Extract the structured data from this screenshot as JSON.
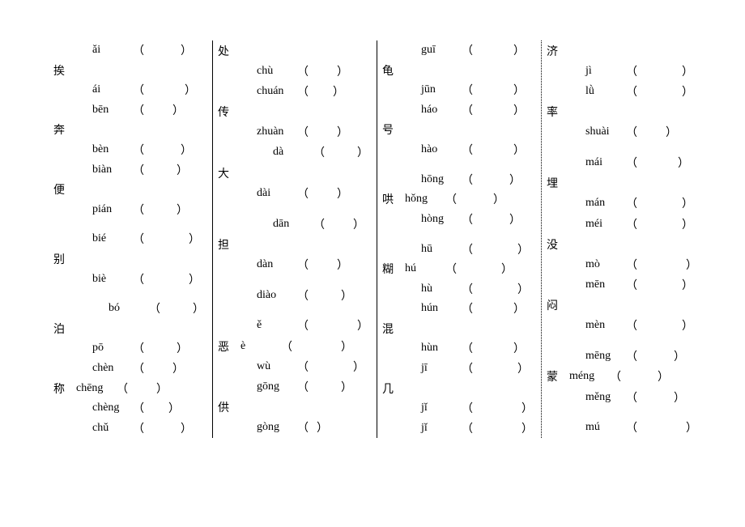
{
  "columns": [
    {
      "rows": [
        {
          "type": "line",
          "char": "",
          "pinyin": "ǎi",
          "indent": 1,
          "blank": 45
        },
        {
          "type": "line",
          "char": "挨",
          "pinyin": "",
          "noparens": true
        },
        {
          "type": "line",
          "char": "",
          "pinyin": "ái",
          "indent": 1,
          "blank": 50
        },
        {
          "type": "line",
          "char": "",
          "pinyin": "bēn",
          "indent": 1,
          "blank": 35
        },
        {
          "type": "line",
          "char": "奔",
          "pinyin": "",
          "noparens": true
        },
        {
          "type": "line",
          "char": "",
          "pinyin": "bèn",
          "indent": 1,
          "blank": 45
        },
        {
          "type": "line",
          "char": "",
          "pinyin": "biàn",
          "indent": 1,
          "blank": 40
        },
        {
          "type": "line",
          "char": "便",
          "pinyin": "",
          "noparens": true
        },
        {
          "type": "line",
          "char": "",
          "pinyin": "pián",
          "indent": 1,
          "blank": 40
        },
        {
          "type": "spacer"
        },
        {
          "type": "line",
          "char": "",
          "pinyin": "bié",
          "indent": 1,
          "blank": 55
        },
        {
          "type": "line",
          "char": "别",
          "pinyin": "",
          "noparens": true
        },
        {
          "type": "line",
          "char": "",
          "pinyin": "biè",
          "indent": 1,
          "blank": 55
        },
        {
          "type": "spacer"
        },
        {
          "type": "line",
          "char": "",
          "pinyin": "bó",
          "indent": 2,
          "blank": 40
        },
        {
          "type": "line",
          "char": "泊",
          "pinyin": "",
          "noparens": true
        },
        {
          "type": "line",
          "char": "",
          "pinyin": "pō",
          "indent": 1,
          "blank": 40
        },
        {
          "type": "line",
          "char": "",
          "pinyin": "chèn",
          "indent": 1,
          "blank": 35
        },
        {
          "type": "line",
          "char": "称",
          "pinyin": "chēng",
          "blank": 35
        },
        {
          "type": "line",
          "char": "",
          "pinyin": "chèng",
          "indent": 1,
          "blank": 30
        },
        {
          "type": "line",
          "char": "",
          "pinyin": "chǔ",
          "indent": 1,
          "blank": 45
        }
      ]
    },
    {
      "rows": [
        {
          "type": "line",
          "char": "处",
          "pinyin": "",
          "noparens": true
        },
        {
          "type": "line",
          "char": "",
          "pinyin": "chù",
          "indent": 1,
          "blank": 35
        },
        {
          "type": "line",
          "char": "",
          "pinyin": "chuán",
          "indent": 1,
          "blank": 30
        },
        {
          "type": "line",
          "char": "传",
          "pinyin": "",
          "noparens": true
        },
        {
          "type": "line",
          "char": "",
          "pinyin": "zhuàn",
          "indent": 1,
          "blank": 35
        },
        {
          "type": "line",
          "char": "",
          "pinyin": "dà",
          "indent": 2,
          "blank": 40
        },
        {
          "type": "line",
          "char": "大",
          "pinyin": "",
          "noparens": true
        },
        {
          "type": "line",
          "char": "",
          "pinyin": "dài",
          "indent": 1,
          "blank": 35
        },
        {
          "type": "spacer"
        },
        {
          "type": "line",
          "char": "",
          "pinyin": "dān",
          "indent": 2,
          "blank": 35
        },
        {
          "type": "line",
          "char": "担",
          "pinyin": "",
          "noparens": true
        },
        {
          "type": "line",
          "char": "",
          "pinyin": "dàn",
          "indent": 1,
          "blank": 35
        },
        {
          "type": "spacer"
        },
        {
          "type": "line",
          "char": "",
          "pinyin": "diào",
          "indent": 1,
          "blank": 40
        },
        {
          "type": "spacer"
        },
        {
          "type": "line",
          "char": "",
          "pinyin": "ě",
          "indent": 1,
          "blank": 60
        },
        {
          "type": "line",
          "char": "恶",
          "pinyin": "è",
          "blank": 60
        },
        {
          "type": "line",
          "char": "",
          "pinyin": "wù",
          "indent": 1,
          "blank": 55
        },
        {
          "type": "line",
          "char": "",
          "pinyin": "gōng",
          "indent": 1,
          "blank": 40
        },
        {
          "type": "line",
          "char": "供",
          "pinyin": "",
          "noparens": true
        },
        {
          "type": "line",
          "char": "",
          "pinyin": "gòng",
          "indent": 1,
          "blank": 10
        }
      ]
    },
    {
      "rows": [
        {
          "type": "line",
          "char": "",
          "pinyin": "guī",
          "indent": 1,
          "blank": 50
        },
        {
          "type": "line",
          "char": "龟",
          "pinyin": "",
          "noparens": true
        },
        {
          "type": "line",
          "char": "",
          "pinyin": "jūn",
          "indent": 1,
          "blank": 50
        },
        {
          "type": "line",
          "char": "",
          "pinyin": "háo",
          "indent": 1,
          "blank": 50
        },
        {
          "type": "line",
          "char": "号",
          "pinyin": "",
          "noparens": true
        },
        {
          "type": "line",
          "char": "",
          "pinyin": "hào",
          "indent": 1,
          "blank": 50
        },
        {
          "type": "spacer"
        },
        {
          "type": "line",
          "char": "",
          "pinyin": "hōng",
          "indent": 1,
          "blank": 45
        },
        {
          "type": "line",
          "char": "哄",
          "pinyin": "hǒng",
          "blank": 45
        },
        {
          "type": "line",
          "char": "",
          "pinyin": "hòng",
          "indent": 1,
          "blank": 45
        },
        {
          "type": "spacer"
        },
        {
          "type": "line",
          "char": "",
          "pinyin": "hū",
          "indent": 1,
          "blank": 55
        },
        {
          "type": "line",
          "char": "糊",
          "pinyin": "hú",
          "blank": 55
        },
        {
          "type": "line",
          "char": "",
          "pinyin": "hù",
          "indent": 1,
          "blank": 55
        },
        {
          "type": "line",
          "char": "",
          "pinyin": "hún",
          "indent": 1,
          "blank": 50
        },
        {
          "type": "line",
          "char": "混",
          "pinyin": "",
          "noparens": true
        },
        {
          "type": "line",
          "char": "",
          "pinyin": "hùn",
          "indent": 1,
          "blank": 50
        },
        {
          "type": "line",
          "char": "",
          "pinyin": "jī",
          "indent": 1,
          "blank": 55
        },
        {
          "type": "line",
          "char": "几",
          "pinyin": "",
          "noparens": true
        },
        {
          "type": "line",
          "char": "",
          "pinyin": "jǐ",
          "indent": 1,
          "blank": 60
        },
        {
          "type": "line",
          "char": "",
          "pinyin": "jǐ",
          "indent": 1,
          "blank": 60
        }
      ]
    },
    {
      "rows": [
        {
          "type": "line",
          "char": "济",
          "pinyin": "",
          "noparens": true
        },
        {
          "type": "line",
          "char": "",
          "pinyin": "jì",
          "indent": 1,
          "blank": 55
        },
        {
          "type": "line",
          "char": "",
          "pinyin": "lǜ",
          "indent": 1,
          "blank": 55
        },
        {
          "type": "line",
          "char": "率",
          "pinyin": "",
          "noparens": true
        },
        {
          "type": "line",
          "char": "",
          "pinyin": "shuài",
          "indent": 1,
          "blank": 35
        },
        {
          "type": "spacer"
        },
        {
          "type": "line",
          "char": "",
          "pinyin": "mái",
          "indent": 1,
          "blank": 50
        },
        {
          "type": "line",
          "char": "埋",
          "pinyin": "",
          "noparens": true
        },
        {
          "type": "line",
          "char": "",
          "pinyin": "mán",
          "indent": 1,
          "blank": 55
        },
        {
          "type": "line",
          "char": "",
          "pinyin": "méi",
          "indent": 1,
          "blank": 55
        },
        {
          "type": "line",
          "char": "没",
          "pinyin": "",
          "noparens": true
        },
        {
          "type": "line",
          "char": "",
          "pinyin": "mò",
          "indent": 1,
          "blank": 60
        },
        {
          "type": "line",
          "char": "",
          "pinyin": "mēn",
          "indent": 1,
          "blank": 55
        },
        {
          "type": "line",
          "char": "闷",
          "pinyin": "",
          "noparens": true
        },
        {
          "type": "line",
          "char": "",
          "pinyin": "mèn",
          "indent": 1,
          "blank": 55
        },
        {
          "type": "spacer"
        },
        {
          "type": "line",
          "char": "",
          "pinyin": "mēng",
          "indent": 1,
          "blank": 45
        },
        {
          "type": "line",
          "char": "蒙",
          "pinyin": "méng",
          "blank": 45
        },
        {
          "type": "line",
          "char": "",
          "pinyin": "měng",
          "indent": 1,
          "blank": 45
        },
        {
          "type": "spacer"
        },
        {
          "type": "line",
          "char": "",
          "pinyin": "mú",
          "indent": 1,
          "blank": 60
        }
      ]
    }
  ]
}
